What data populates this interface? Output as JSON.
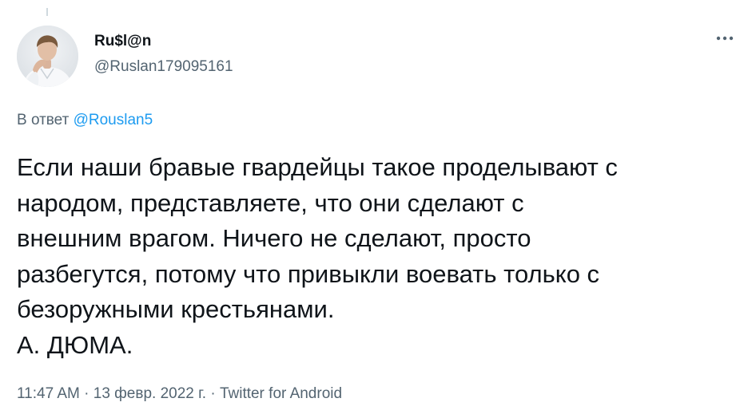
{
  "tweet": {
    "author": {
      "display_name": "Ru$l@n",
      "handle": "@Ruslan179095161",
      "avatar": "avatar-photo"
    },
    "more_icon": "more-horizontal-icon",
    "reply_prefix": "В ответ",
    "reply_mention": "@Rouslan5",
    "text_lines": [
      "Если наши бравые гвардейцы такое проделывают с",
      "народом, представляете, что они сделают с",
      "внешним врагом. Ничего не сделают, просто",
      "разбегутся, потому что привыкли воевать только с",
      "безоружными крестьянами.",
      "А. ДЮМА."
    ],
    "time": "11:47 AM",
    "separator": "·",
    "date": "13 февр. 2022 г.",
    "source": "Twitter for Android"
  },
  "colors": {
    "text": "#0f1419",
    "secondary": "#536471",
    "accent": "#1d9bf0",
    "thread_line": "#cfd9de"
  }
}
